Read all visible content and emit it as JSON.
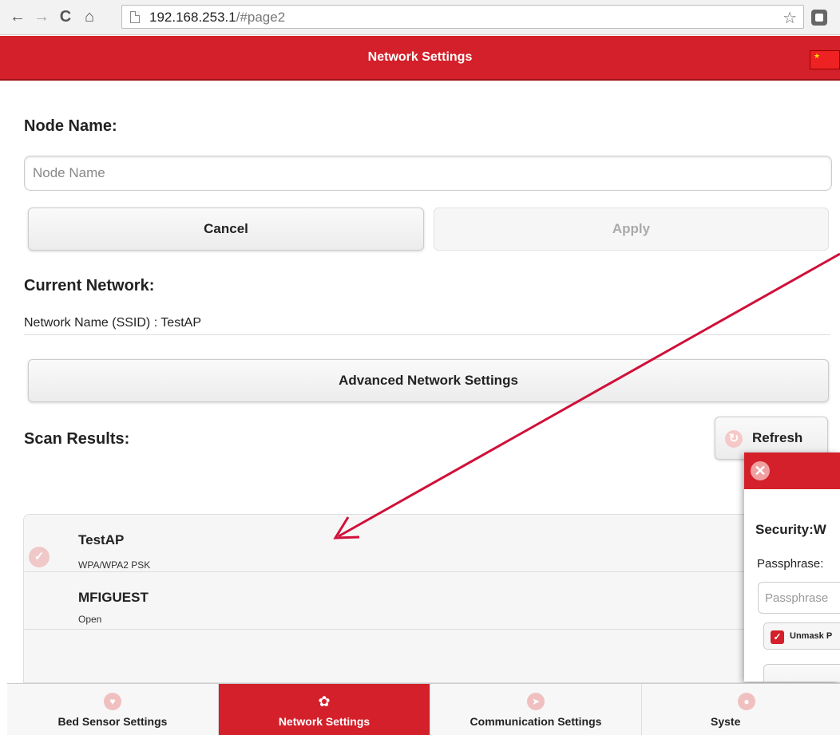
{
  "browser": {
    "url_host": "192.168.253.1",
    "url_path": "/#page2",
    "back_icon": "←",
    "forward_icon": "→",
    "reload_icon": "C",
    "home_icon": "⌂",
    "star_icon": "☆"
  },
  "header": {
    "title": "Network Settings",
    "flag_icon": "china-flag-icon"
  },
  "node_name": {
    "heading": "Node Name:",
    "placeholder": "Node Name",
    "value": ""
  },
  "actions": {
    "cancel_label": "Cancel",
    "apply_label": "Apply"
  },
  "current_network": {
    "heading": "Current Network:",
    "ssid_line": "Network Name (SSID) : TestAP",
    "advanced_label": "Advanced Network Settings"
  },
  "scan": {
    "heading": "Scan Results:",
    "refresh_label": "Refresh",
    "refresh_icon": "↻",
    "results": [
      {
        "ssid": "TestAP",
        "security": "WPA/WPA2 PSK",
        "connected": true,
        "check_icon": "✓"
      },
      {
        "ssid": "MFIGUEST",
        "security": "Open",
        "connected": false
      }
    ]
  },
  "popup": {
    "close_icon": "✕",
    "security_text": "Security:W",
    "passphrase_label": "Passphrase:",
    "passphrase_placeholder": "Passphrase",
    "unmask_label": "Unmask P",
    "unmask_checked": true,
    "check_icon": "✓"
  },
  "bottom_nav": {
    "tabs": [
      {
        "label": "Bed Sensor Settings",
        "icon": "heart-icon",
        "glyph": "♥",
        "active": false
      },
      {
        "label": "Network Settings",
        "icon": "gear-icon",
        "glyph": "✿",
        "active": true
      },
      {
        "label": "Communication Settings",
        "icon": "navigation-icon",
        "glyph": "➤",
        "active": false
      },
      {
        "label": "Syste",
        "icon": "system-icon",
        "glyph": "●",
        "active": false
      }
    ]
  },
  "colors": {
    "brand_red": "#d3202a",
    "annotation_arrow": "#d0103a"
  }
}
